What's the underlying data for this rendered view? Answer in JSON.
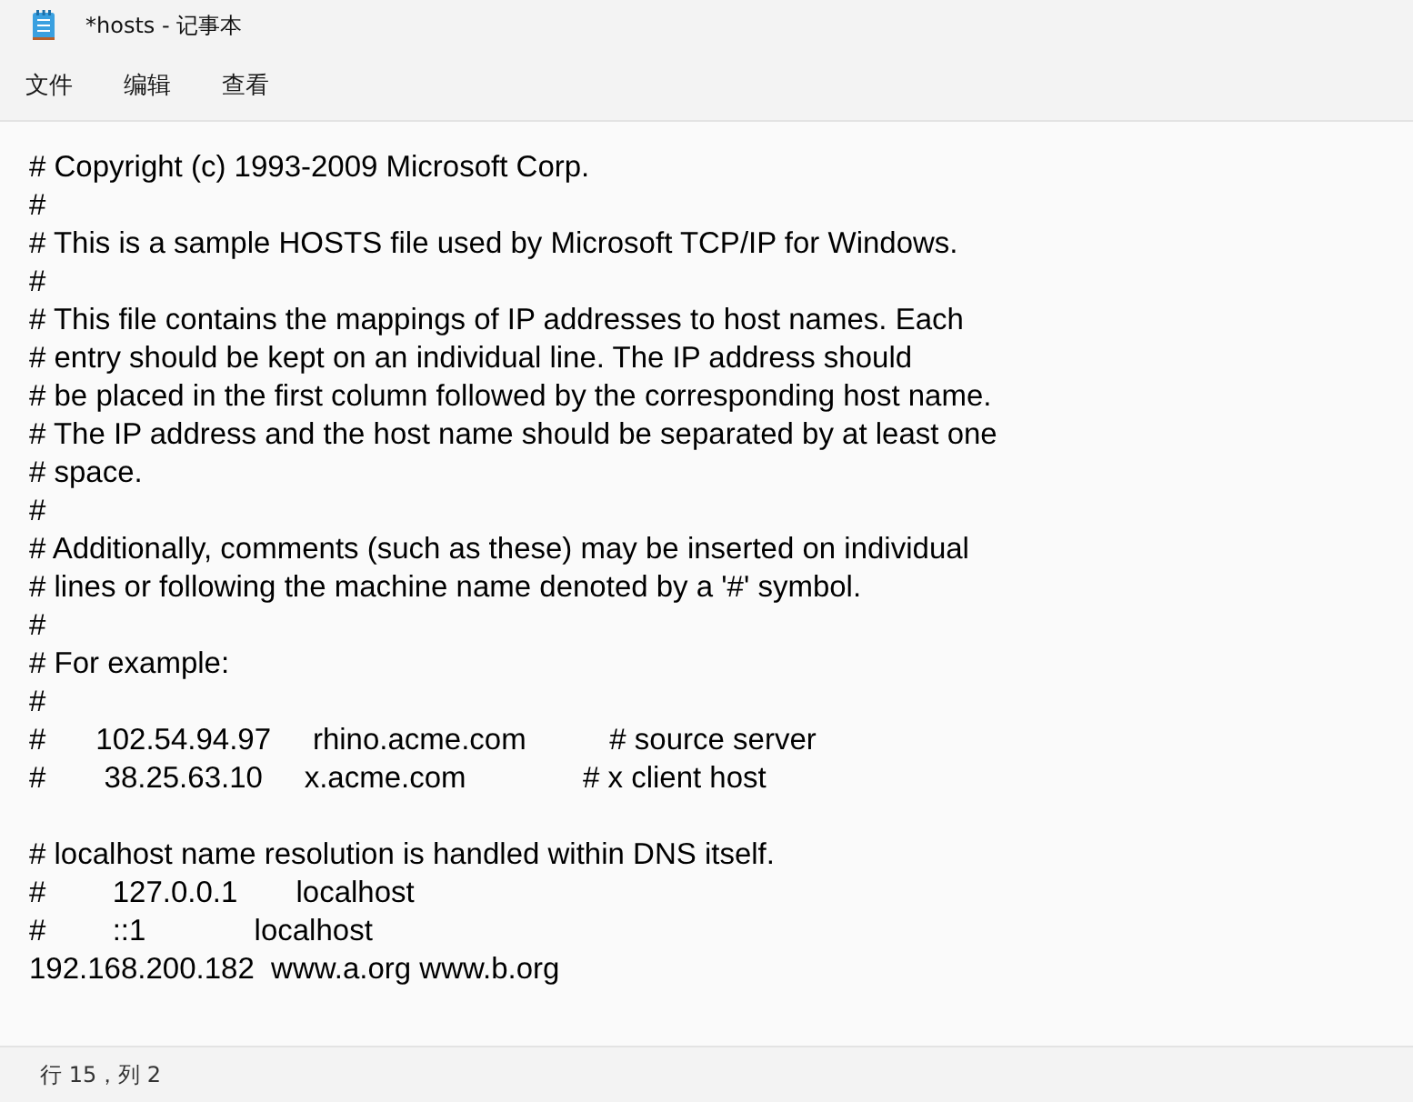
{
  "window": {
    "title": "*hosts - 记事本"
  },
  "menu": [
    "文件",
    "编辑",
    "查看"
  ],
  "editor": {
    "blocks": [
      [
        "# Copyright (c) 1993-2009 Microsoft Corp.",
        "#",
        "# This is a sample HOSTS file used by Microsoft TCP/IP for Windows.",
        "#",
        "# This file contains the mappings of IP addresses to host names. Each",
        "# entry should be kept on an individual line. The IP address should",
        "# be placed in the first column followed by the corresponding host name.",
        "# The IP address and the host name should be separated by at least one",
        "# space.",
        "#",
        "# Additionally, comments (such as these) may be inserted on individual",
        "# lines or following the machine name denoted by a '#' symbol.",
        "#",
        "# For example:",
        "#",
        "#      102.54.94.97     rhino.acme.com          # source server",
        "#       38.25.63.10     x.acme.com              # x client host"
      ],
      [
        "# localhost name resolution is handled within DNS itself.",
        "#        127.0.0.1       localhost",
        "#        ::1             localhost",
        "192.168.200.182  www.a.org www.b.org"
      ]
    ]
  },
  "status_bar": {
    "position": "行 15，列 2"
  }
}
